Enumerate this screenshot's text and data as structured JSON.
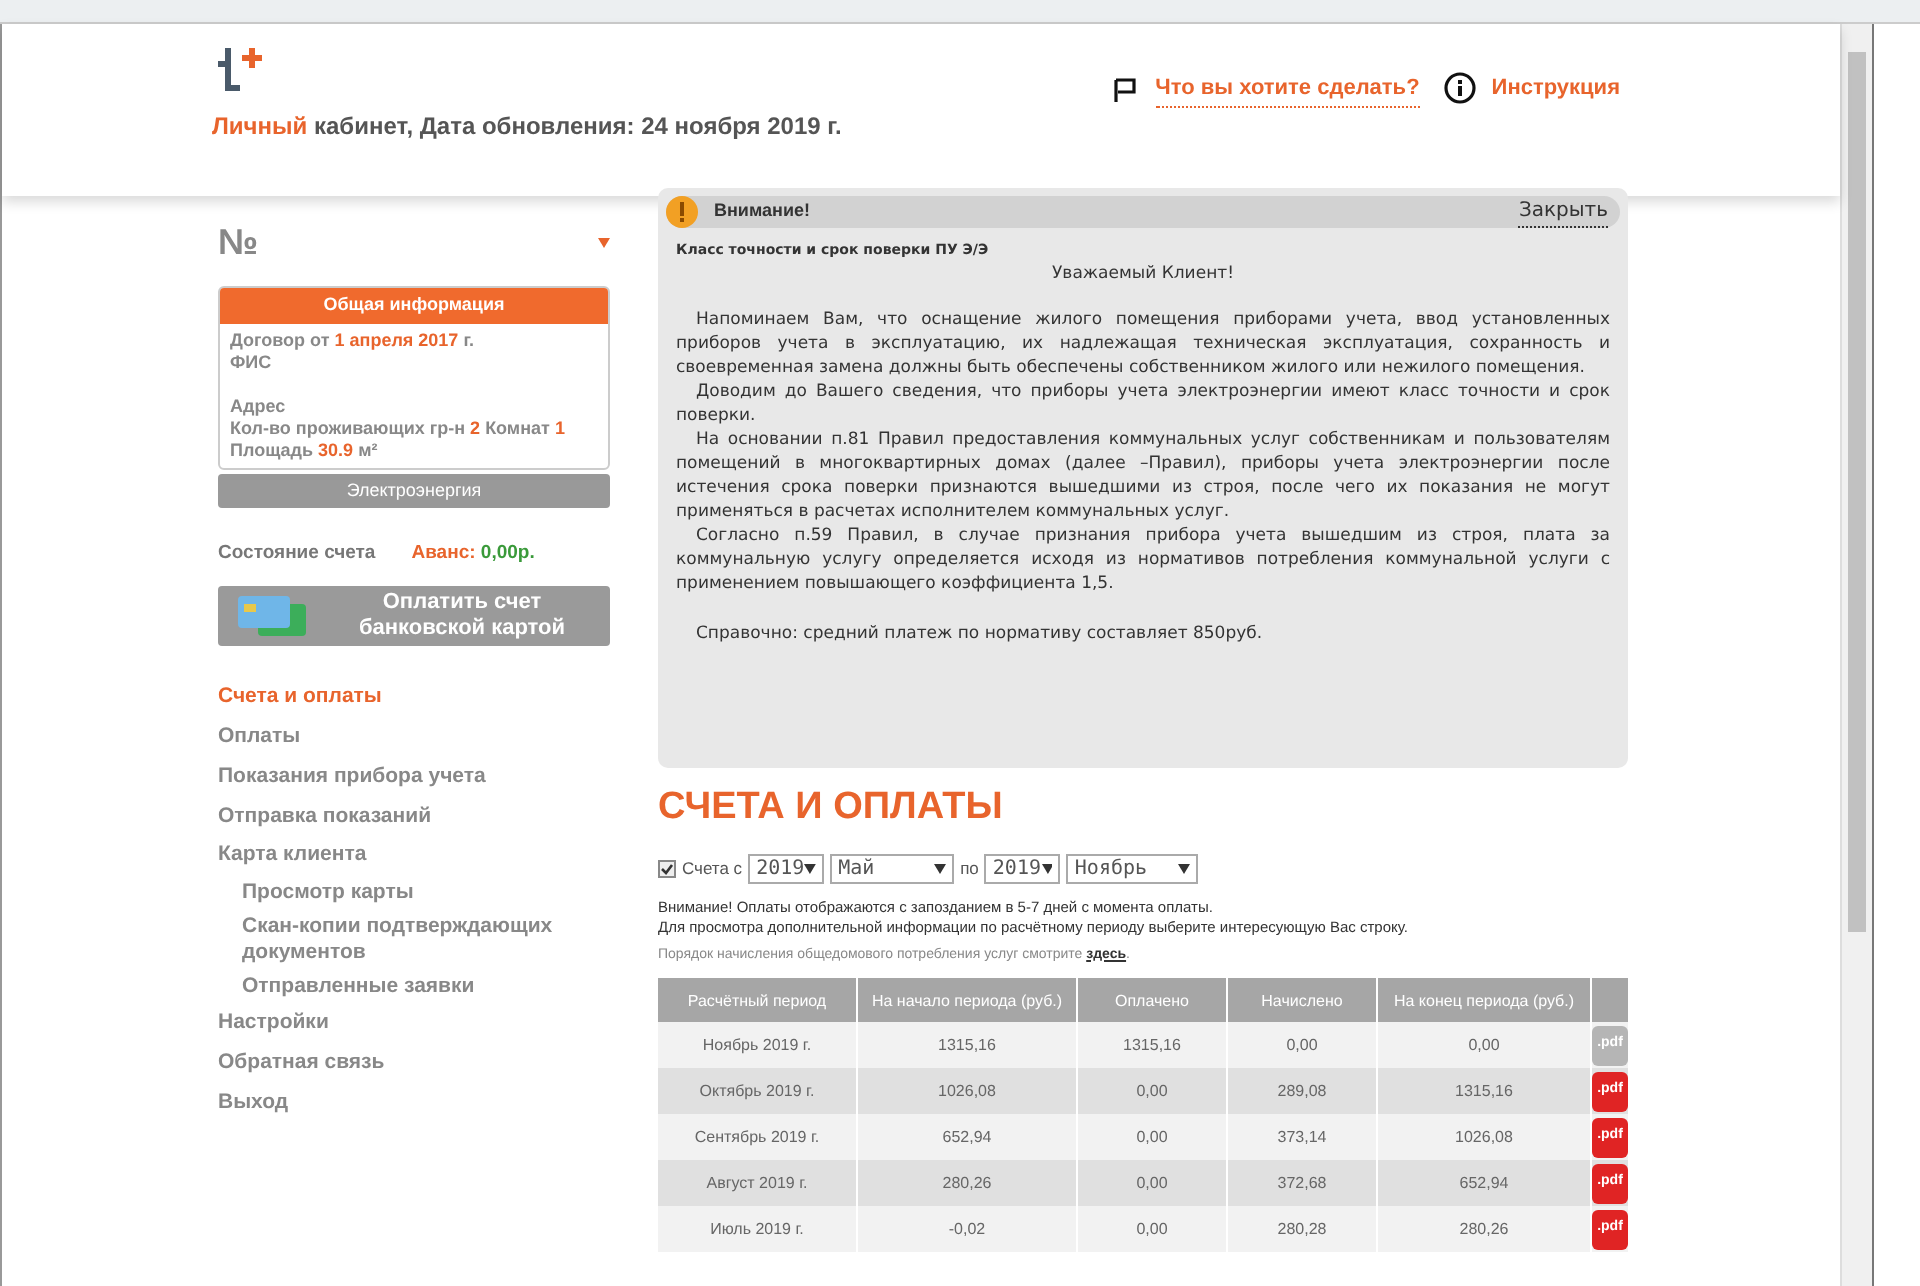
{
  "header": {
    "title_highlight": "Личный",
    "title_rest": "кабинет, Дата обновления: 24 ноября 2019 г.",
    "links": [
      {
        "kind": "flag",
        "label": "Что вы хотите сделать?"
      },
      {
        "kind": "info",
        "label": "Инструкция"
      }
    ]
  },
  "sidebar": {
    "account_label": "№",
    "info_card": {
      "title": "Общая информация",
      "groups": [
        {
          "lines": [
            {
              "segments": [
                {
                  "text": "Договор от ",
                  "highlight": false
                },
                {
                  "text": "1 апреля 2017",
                  "highlight": true
                },
                {
                  "text": " г.",
                  "highlight": false
                }
              ]
            },
            {
              "segments": [
                {
                  "text": "ФИС",
                  "highlight": false
                }
              ]
            }
          ]
        },
        {
          "lines": [
            {
              "segments": [
                {
                  "text": "Адрес",
                  "highlight": false
                }
              ]
            },
            {
              "segments": [
                {
                  "text": "Кол-во проживающих гр-н ",
                  "highlight": false
                },
                {
                  "text": "2",
                  "highlight": true
                },
                {
                  "text": " Комнат ",
                  "highlight": false
                },
                {
                  "text": "1",
                  "highlight": true
                }
              ]
            },
            {
              "segments": [
                {
                  "text": "Площадь ",
                  "highlight": false
                },
                {
                  "text": "30.9",
                  "highlight": true
                },
                {
                  "text": " м²",
                  "highlight": false
                }
              ]
            }
          ]
        }
      ]
    },
    "service_tab": "Электроэнергия",
    "account_status": {
      "label": "Состояние счета",
      "balance_label": "Аванс:",
      "balance_value": "0,00р."
    },
    "pay_button": {
      "lines": [
        "Оплатить счет",
        "банковской картой"
      ]
    },
    "nav": [
      {
        "label": "Счета и оплаты",
        "selected": true
      },
      {
        "label": "Оплаты",
        "selected": false
      },
      {
        "label": "Показания прибора учета",
        "selected": false
      },
      {
        "label": "Отправка показаний",
        "selected": false
      },
      {
        "label": "Карта клиента",
        "selected": false,
        "children": [
          {
            "label": "Просмотр карты",
            "selected": false
          },
          {
            "label": "Скан-копии подтверждающих документов",
            "selected": false
          },
          {
            "label": "Отправленные заявки",
            "selected": false
          }
        ]
      },
      {
        "label": "Настройки",
        "selected": false
      },
      {
        "label": "Обратная связь",
        "selected": false
      },
      {
        "label": "Выход",
        "selected": false
      }
    ]
  },
  "notice": {
    "title": "Внимание!",
    "close": "Закрыть",
    "subject": "Класс точности и срок поверки ПУ Э/Э",
    "greeting": "Уважаемый Клиент!",
    "paragraphs": [
      "Напоминаем Вам, что оснащение жилого помещения приборами учета, ввод установленных приборов учета в эксплуатацию, их надлежащая техническая эксплуатация, сохранность и своевременная замена должны быть обеспечены собственником жилого или нежилого помещения.",
      "Доводим до Вашего сведения, что приборы учета электроэнергии имеют класс точности и срок поверки.",
      "На основании п.81 Правил предоставления коммунальных услуг собственникам и пользователям помещений в многоквартирных домах (далее –Правил), приборы учета электроэнергии после истечения срока поверки признаются вышедшими из строя, после чего их показания не могут применяться в расчетах исполнителем коммунальных услуг.",
      "Согласно п.59 Правил, в случае признания прибора учета вышедшим из строя, плата за коммунальную услугу определяется исходя из нормативов потребления коммунальной услуги с применением повышающего коэффициента 1,5."
    ],
    "note": "Справочно: средний платеж по нормативу составляет 850руб."
  },
  "bills": {
    "title": "СЧЕТА И ОПЛАТЫ",
    "filter": {
      "checked": true,
      "label": "Счета с",
      "from_year": "2019",
      "from_month": "Май",
      "to_label": "по",
      "to_year": "2019",
      "to_month": "Ноябрь"
    },
    "notes": [
      "Внимание! Оплаты отображаются с запозданием в 5-7 дней с момента оплаты.",
      "Для просмотра дополнительной информации по расчётному периоду выберите интересующую Вас строку."
    ],
    "hint": {
      "text": "Порядок начисления общедомового потребления услуг смотрите ",
      "link": "здесь",
      "end": "."
    },
    "table": {
      "columns": [
        "Расчётный период",
        "На начало периода (руб.)",
        "Оплачено",
        "Начислено",
        "На конец периода (руб.)"
      ],
      "rows": [
        {
          "cells": [
            "Ноябрь 2019 г.",
            "1315,16",
            "1315,16",
            "0,00",
            "0,00"
          ],
          "file": {
            "label": ".pdf",
            "available": false
          }
        },
        {
          "cells": [
            "Октябрь 2019 г.",
            "1026,08",
            "0,00",
            "289,08",
            "1315,16"
          ],
          "file": {
            "label": ".pdf",
            "available": true
          }
        },
        {
          "cells": [
            "Сентябрь 2019 г.",
            "652,94",
            "0,00",
            "373,14",
            "1026,08"
          ],
          "file": {
            "label": ".pdf",
            "available": true
          }
        },
        {
          "cells": [
            "Август 2019 г.",
            "280,26",
            "0,00",
            "372,68",
            "652,94"
          ],
          "file": {
            "label": ".pdf",
            "available": true
          }
        },
        {
          "cells": [
            "Июль 2019 г.",
            "-0,02",
            "0,00",
            "280,28",
            "280,26"
          ],
          "file": {
            "label": ".pdf",
            "available": true
          }
        }
      ]
    }
  }
}
